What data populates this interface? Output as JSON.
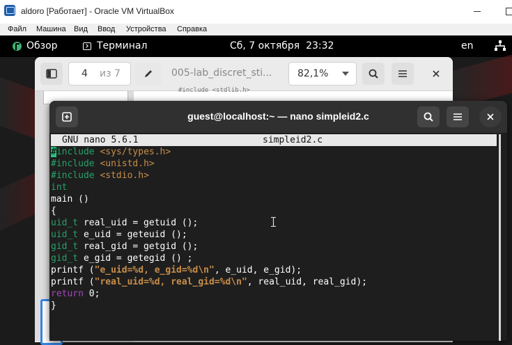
{
  "vbox": {
    "title": "aldoro [Работает] - Oracle VM VirtualBox",
    "menu": [
      "Файл",
      "Машина",
      "Вид",
      "Ввод",
      "Устройства",
      "Справка"
    ]
  },
  "gnome": {
    "activities": "Обзор",
    "app_name": "Терминал",
    "clock": "Сб, 7 октября  23:32",
    "keyboard_layout": "en"
  },
  "doc_viewer": {
    "page_current": "4",
    "page_total": "из 7",
    "document_title": "005-lab_discret_sti...",
    "zoom": "82,1%",
    "page_snippet": "#include <stdlib.h>"
  },
  "terminal": {
    "title": "guest@localhost:~ — nano simpleid2.c",
    "nano_version": "GNU nano 5.6.1",
    "filename": "simpleid2.c",
    "lines": [
      {
        "hash": "#",
        "kw": "include",
        "rest": " <sys/types.h>"
      },
      {
        "hash": "#",
        "kw": "include",
        "rest": " <unistd.h>"
      },
      {
        "hash": "#",
        "kw": "include",
        "rest": " <stdio.h>"
      },
      {
        "kw": "int"
      },
      {
        "plain": "main ()"
      },
      {
        "plain": "{"
      },
      {
        "type": "uid_t",
        "rest": " real_uid = getuid ();"
      },
      {
        "type": "uid_t",
        "rest": " e_uid = geteuid ();"
      },
      {
        "type": "gid_t",
        "rest": " real_gid = getgid ();"
      },
      {
        "type": "gid_t",
        "rest": " e_gid = getegid () ;"
      },
      {
        "pre": "printf (",
        "str": "\"e_uid=%d, e_gid=%d",
        "esc": "\\n",
        "strend": "\"",
        "post": ", e_uid, e_gid);"
      },
      {
        "pre": "printf (",
        "str": "\"real_uid=%d, real_gid=%d",
        "esc": "\\n",
        "strend": "\"",
        "post": ", real_uid, real_gid);"
      },
      {
        "ret": "return",
        "rest": " 0;"
      },
      {
        "plain": "}"
      }
    ]
  },
  "colors": {
    "keyword": "#26a269",
    "header": "#c88e4a",
    "return": "#a347ba",
    "terminal_bg": "#1e1e1e",
    "cursor": "#2ec27e"
  }
}
